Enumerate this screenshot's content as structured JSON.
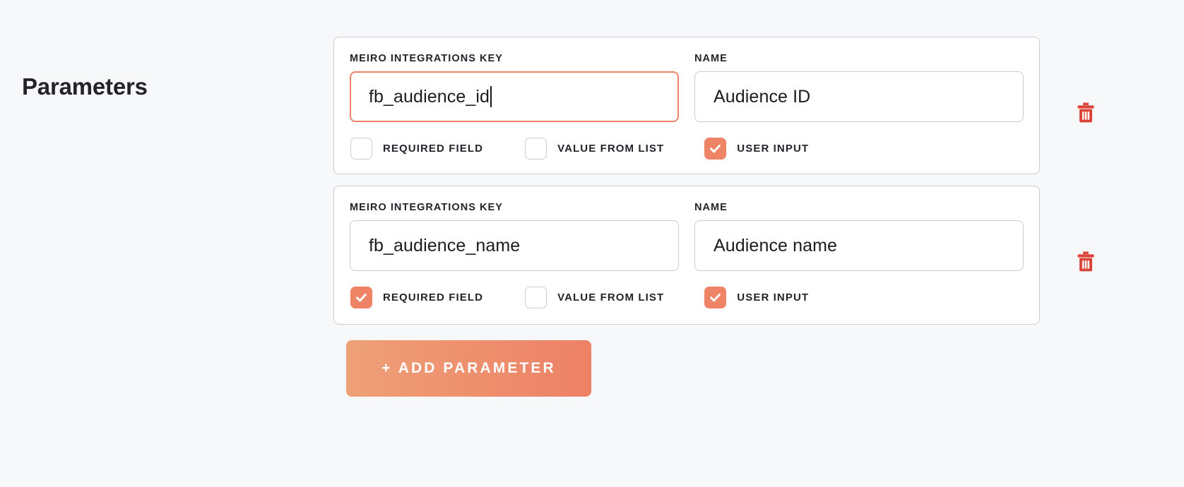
{
  "page": {
    "title": "Parameters",
    "background_color": "#F7F8FA",
    "accent_color": "#EF8366",
    "danger_color": "#DB4437"
  },
  "labels": {
    "key_label": "MEIRO INTEGRATIONS KEY",
    "name_label": "NAME",
    "required_field": "REQUIRED FIELD",
    "value_from_list": "VALUE FROM LIST",
    "user_input": "USER INPUT",
    "delete_icon": "trash-icon"
  },
  "parameters": [
    {
      "key_value": "fb_audience_id",
      "key_focused": true,
      "name_value": "Audience ID",
      "name_focused": false,
      "required_field": false,
      "value_from_list": false,
      "user_input": true
    },
    {
      "key_value": "fb_audience_name",
      "key_focused": false,
      "name_value": "Audience name",
      "name_focused": false,
      "required_field": true,
      "value_from_list": false,
      "user_input": true
    }
  ],
  "add_button": {
    "label": "+ ADD PARAMETER"
  }
}
